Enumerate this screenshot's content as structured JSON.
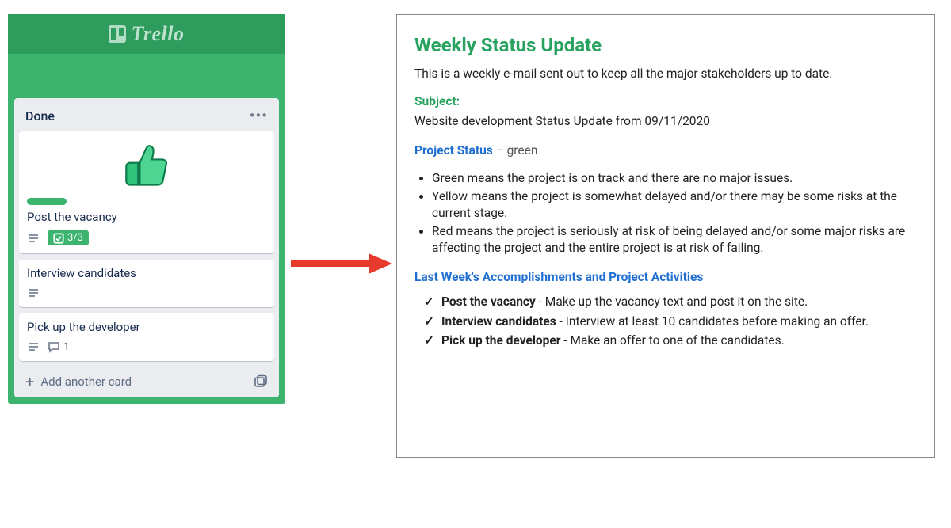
{
  "trello": {
    "brand": "Trello",
    "list": {
      "title": "Done",
      "addCardLabel": "Add another card"
    },
    "cards": [
      {
        "title": "Post the vacancy",
        "hasCover": true,
        "hasGreenLabel": true,
        "checklist": "3/3",
        "hasDescription": true
      },
      {
        "title": "Interview candidates",
        "hasDescription": true
      },
      {
        "title": "Pick up the developer",
        "hasDescription": true,
        "comments": "1"
      }
    ]
  },
  "document": {
    "title": "Weekly Status Update",
    "intro": "This is a weekly e-mail sent out to keep all the major stakeholders up to date.",
    "subjectLabel": "Subject:",
    "subjectValue": "Website development Status Update from 09/11/2020",
    "projectStatusLabel": "Project Status",
    "projectStatusSuffix": " – green",
    "statusDefinitions": [
      "Green means the project is on track and there are no major issues.",
      "Yellow means the project is somewhat delayed and/or there may be some risks at the current stage.",
      "Red means the project is seriously at risk of being delayed and/or some major risks are affecting the project and the entire project is at risk of failing."
    ],
    "accomplishmentsHeading": "Last Week's Accomplishments and Project Activities",
    "accomplishments": [
      {
        "title": "Post the vacancy",
        "desc": " - Make up the vacancy text and post it on the site."
      },
      {
        "title": "Interview candidates",
        "desc": " - Interview at least 10 candidates before making an offer."
      },
      {
        "title": "Pick up the developer",
        "desc": " - Make an offer to one of the candidates."
      }
    ]
  }
}
